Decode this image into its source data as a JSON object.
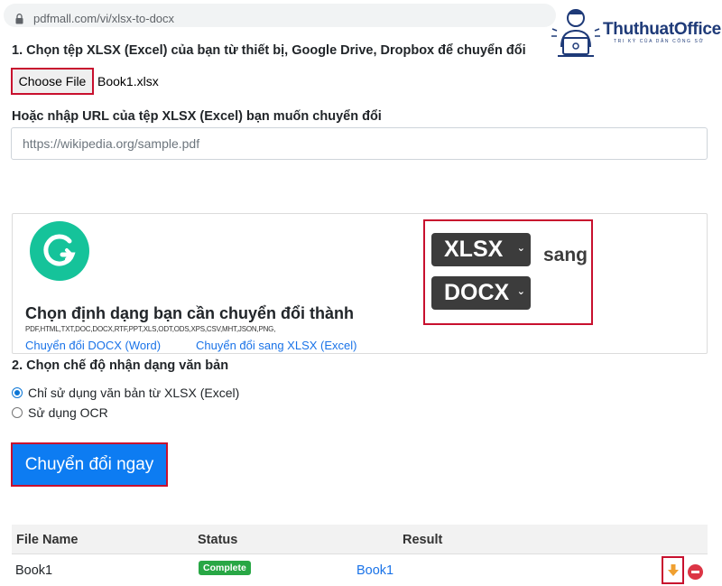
{
  "browser": {
    "url": "pdfmall.com/vi/xlsx-to-docx"
  },
  "logo": {
    "name": "ThuthuatOffice",
    "tagline": "TRI KỲ CỦA DÂN CÔNG SỞ"
  },
  "step1": {
    "label": "1. Chọn tệp XLSX (Excel) của bạn từ thiết bị, Google Drive, Dropbox để chuyển đổi",
    "choose_button": "Choose File",
    "file_name": "Book1.xlsx",
    "url_label": "Hoặc nhập URL của tệp XLSX (Excel) bạn muốn chuyển đổi",
    "url_placeholder": "https://wikipedia.org/sample.pdf"
  },
  "format_card": {
    "title": "Chọn định dạng bạn cần chuyển đổi thành",
    "formats": "PDF,HTML,TXT,DOC,DOCX,RTF,PPT,XLS,ODT,ODS,XPS,CSV,MHT,JSON,PNG,",
    "link1": "Chuyển đổi DOCX (Word)",
    "link2": "Chuyển đổi sang XLSX (Excel)",
    "from_format": "XLSX",
    "connector": "sang",
    "to_format": "DOCX"
  },
  "step2": {
    "label": "2. Chọn chế độ nhận dạng văn bản",
    "option1": "Chỉ sử dụng văn bản từ XLSX (Excel)",
    "option2": "Sử dụng OCR",
    "selected": "option1"
  },
  "convert_button": "Chuyển đổi ngay",
  "results": {
    "headers": [
      "File Name",
      "Status",
      "Result"
    ],
    "rows": [
      {
        "file_name": "Book1",
        "status": "Complete",
        "result": "Book1"
      }
    ]
  },
  "colors": {
    "highlight": "#c8102e",
    "primary": "#0d7cf2",
    "success": "#28a745",
    "danger": "#dc3545",
    "download": "#f0a030",
    "grammarly": "#15c39a"
  }
}
